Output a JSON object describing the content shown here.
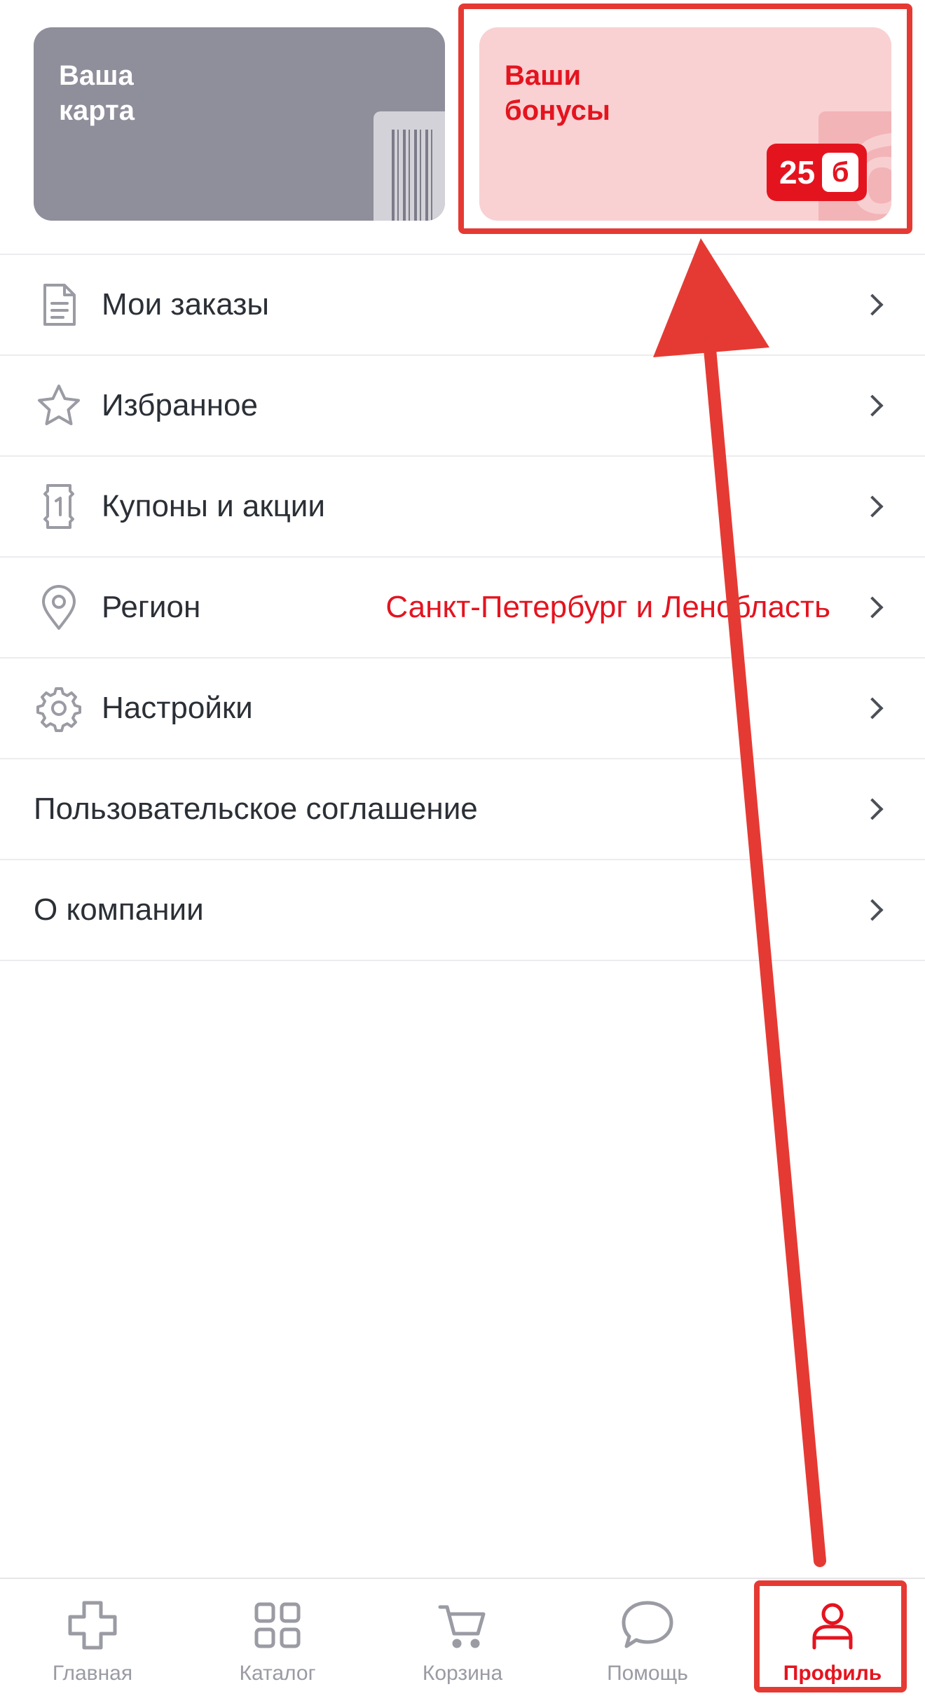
{
  "cards": {
    "card": {
      "title": "Ваша\nкарта"
    },
    "bonuses": {
      "title": "Ваши\nбонусы",
      "value": "25",
      "unit": "б"
    }
  },
  "menu": [
    {
      "id": "orders",
      "label": "Мои заказы",
      "icon": "document-icon"
    },
    {
      "id": "favorites",
      "label": "Избранное",
      "icon": "star-icon"
    },
    {
      "id": "coupons",
      "label": "Купоны и акции",
      "icon": "coupon-icon"
    },
    {
      "id": "region",
      "label": "Регион",
      "value": "Санкт-Петербург и Ленобласть",
      "icon": "location-pin-icon"
    },
    {
      "id": "settings",
      "label": "Настройки",
      "icon": "gear-icon"
    },
    {
      "id": "agreement",
      "label": "Пользовательское соглашение"
    },
    {
      "id": "about",
      "label": "О компании"
    }
  ],
  "tabbar": [
    {
      "id": "home",
      "label": "Главная",
      "icon": "cross-icon"
    },
    {
      "id": "catalog",
      "label": "Каталог",
      "icon": "grid-icon"
    },
    {
      "id": "cart",
      "label": "Корзина",
      "icon": "cart-icon"
    },
    {
      "id": "help",
      "label": "Помощь",
      "icon": "chat-bubble-icon"
    },
    {
      "id": "profile",
      "label": "Профиль",
      "icon": "user-icon",
      "active": true
    }
  ],
  "colors": {
    "accent": "#e4141f",
    "annotation": "#e53a33",
    "icon_gray": "#9a9ba3",
    "card_gray": "#8f8e9b",
    "card_pink": "#f9d1d2"
  }
}
